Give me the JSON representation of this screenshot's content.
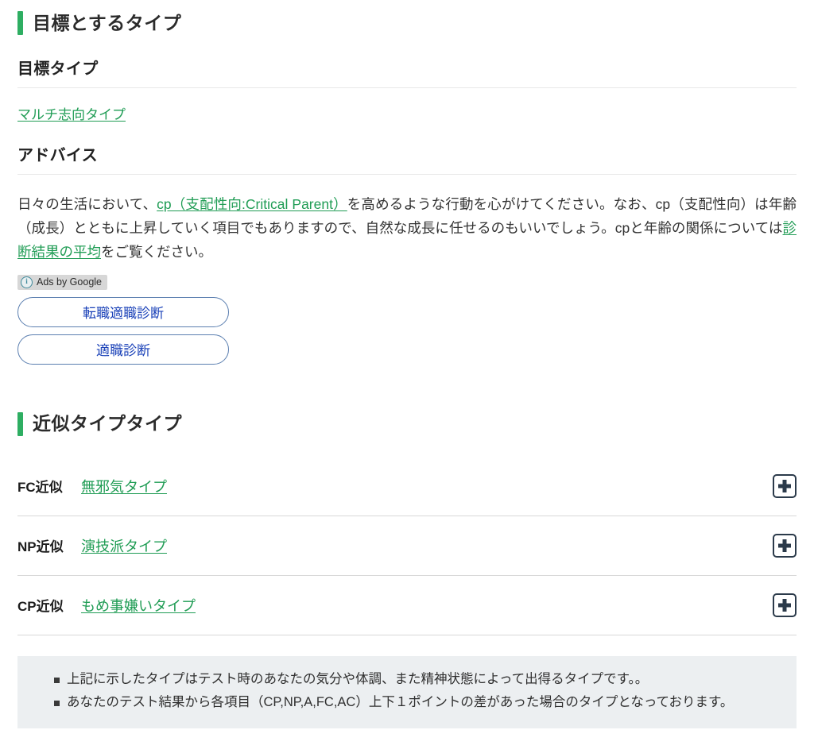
{
  "target_section": {
    "heading": "目標とするタイプ",
    "goal_type": {
      "sub_heading": "目標タイプ",
      "link_label": "マルチ志向タイプ"
    },
    "advice": {
      "sub_heading": "アドバイス",
      "text_part1": "日々の生活において、",
      "link1_label": "cp（支配性向:Critical Parent）",
      "text_part2": "を高めるような行動を心がけてください。なお、cp（支配性向）は年齢（成長）とともに上昇していく項目でもありますので、自然な成長に任せるのもいいでしょう。cpと年齢の関係については",
      "link2_label": "診断結果の平均",
      "text_part3": "をご覧ください。"
    }
  },
  "ads": {
    "badge_label": "Ads by Google",
    "info_icon_glyph": "i",
    "buttons": [
      {
        "label": "転職適職診断"
      },
      {
        "label": "適職診断"
      }
    ],
    "border_color": "#5B7FB0",
    "text_color": "#1A41B8"
  },
  "similar_section": {
    "heading": "近似タイプタイプ",
    "rows": [
      {
        "label": "FC近似",
        "link_label": "無邪気タイプ",
        "expand_icon": "plus-icon"
      },
      {
        "label": "NP近似",
        "link_label": "演技派タイプ",
        "expand_icon": "plus-icon"
      },
      {
        "label": "CP近似",
        "link_label": "もめ事嫌いタイプ",
        "expand_icon": "plus-icon"
      }
    ]
  },
  "notes": {
    "items": [
      "上記に示したタイプはテスト時のあなたの気分や体調、また精神状態によって出得るタイプです。。",
      "あなたのテスト結果から各項目（CP,NP,A,FC,AC）上下１ポイントの差があった場合のタイプとなっております。"
    ]
  },
  "theme": {
    "accent_green": "#2EAE62",
    "link_green": "#1F9C54",
    "notes_bg": "#ECEFF1",
    "plus_icon_color": "#2B3A4A"
  }
}
